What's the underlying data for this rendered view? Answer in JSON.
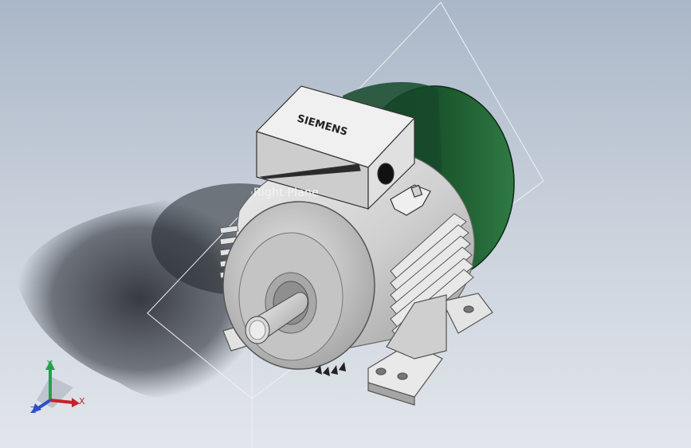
{
  "viewport": {
    "plane_label": "Right Plane"
  },
  "model": {
    "brand_text": "SIEMENS",
    "fan_cover_color": "#1d5a2e",
    "body_color": "#d4d4d4"
  },
  "triad": {
    "x_label": "X",
    "y_label": "Y",
    "z_label": "Z",
    "x_color": "#c8202a",
    "y_color": "#22a24a",
    "z_color": "#2a4fc8"
  }
}
